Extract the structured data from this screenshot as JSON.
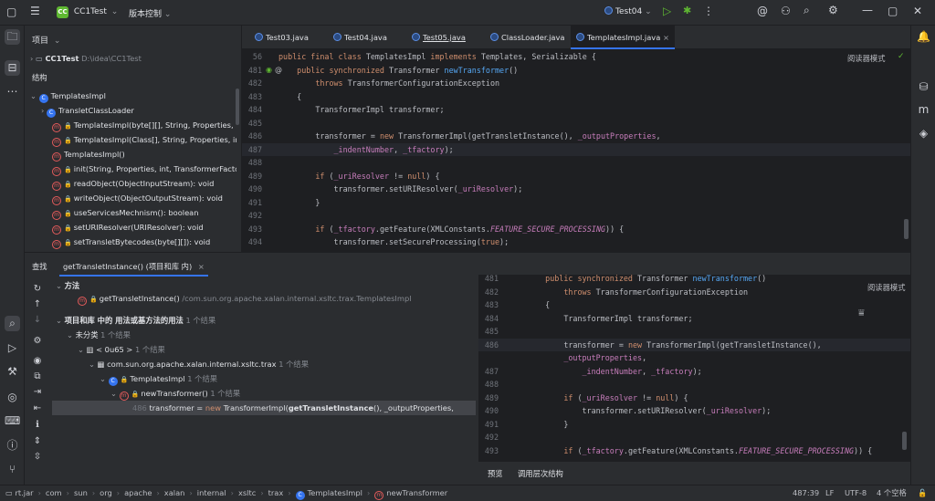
{
  "titlebar": {
    "project_badge": "CC",
    "project_name": "CC1Test",
    "project_caret": "⌄",
    "vcs_label": "版本控制",
    "vcs_caret": "⌄",
    "run_config": "Test04",
    "run_caret": "⌄"
  },
  "project_panel": {
    "title": "项目",
    "title_caret": "⌄",
    "root_name": "CC1Test",
    "root_path": "D:\\idea\\CC1Test",
    "structure_title": "结构",
    "items": [
      "TemplatesImpl",
      "TransletClassLoader",
      "TemplatesImpl(byte[][], String, Properties, int, Tr",
      "TemplatesImpl(Class[], String, Properties, int, Tra",
      "TemplatesImpl()",
      "init(String, Properties, int, TransformerFactoryIm",
      "readObject(ObjectInputStream): void",
      "writeObject(ObjectOutputStream): void",
      "useServicesMechnism(): boolean",
      "setURIResolver(URIResolver): void",
      "setTransletBytecodes(byte[][]): void"
    ]
  },
  "tabs": [
    "Test03.java",
    "Test04.java",
    "Test05.java",
    "ClassLoader.java",
    "TemplatesImpl.java"
  ],
  "reader_mode": "阅读器模式",
  "editor": {
    "lines": [
      {
        "n": "56",
        "segs": [
          [
            "kw",
            "public final class "
          ],
          [
            "cls",
            "TemplatesImpl "
          ],
          [
            "kw",
            "implements "
          ],
          [
            "cls",
            "Templates, Serializable {"
          ]
        ]
      },
      {
        "n": "481",
        "segs": [
          [
            "kw",
            "    public synchronized "
          ],
          [
            "cls",
            "Transformer "
          ],
          [
            "fn",
            "newTransformer"
          ],
          [
            "cls",
            "()"
          ]
        ]
      },
      {
        "n": "482",
        "segs": [
          [
            "kw",
            "        throws "
          ],
          [
            "cls",
            "TransformerConfigurationException"
          ]
        ]
      },
      {
        "n": "483",
        "segs": [
          [
            "cls",
            "    {"
          ]
        ]
      },
      {
        "n": "484",
        "segs": [
          [
            "cls",
            "        TransformerImpl transformer;"
          ]
        ]
      },
      {
        "n": "485",
        "segs": [
          [
            "cls",
            ""
          ]
        ]
      },
      {
        "n": "486",
        "segs": [
          [
            "cls",
            "        transformer = "
          ],
          [
            "kw",
            "new "
          ],
          [
            "cls",
            "TransformerImpl(getTransletInstance(), "
          ],
          [
            "fld",
            "_outputProperties"
          ],
          [
            "cls",
            ","
          ]
        ]
      },
      {
        "n": "487",
        "segs": [
          [
            "cls",
            "            "
          ],
          [
            "fld",
            "_indentNumber"
          ],
          [
            "cls",
            ", "
          ],
          [
            "fld",
            "_tfactory"
          ],
          [
            "cls",
            ");"
          ]
        ]
      },
      {
        "n": "488",
        "segs": [
          [
            "cls",
            ""
          ]
        ]
      },
      {
        "n": "489",
        "segs": [
          [
            "kw",
            "        if "
          ],
          [
            "cls",
            "("
          ],
          [
            "fld",
            "_uriResolver "
          ],
          [
            "cls",
            "!= "
          ],
          [
            "kw",
            "null"
          ],
          [
            "cls",
            ") {"
          ]
        ]
      },
      {
        "n": "490",
        "segs": [
          [
            "cls",
            "            transformer.setURIResolver("
          ],
          [
            "fld",
            "_uriResolver"
          ],
          [
            "cls",
            ");"
          ]
        ]
      },
      {
        "n": "491",
        "segs": [
          [
            "cls",
            "        }"
          ]
        ]
      },
      {
        "n": "492",
        "segs": [
          [
            "cls",
            ""
          ]
        ]
      },
      {
        "n": "493",
        "segs": [
          [
            "kw",
            "        if "
          ],
          [
            "cls",
            "("
          ],
          [
            "fld",
            "_tfactory"
          ],
          [
            "cls",
            ".getFeature(XMLConstants."
          ],
          [
            "fld-it",
            "FEATURE_SECURE_PROCESSING"
          ],
          [
            "cls",
            ")) {"
          ]
        ]
      },
      {
        "n": "494",
        "segs": [
          [
            "cls",
            "            transformer.setSecureProcessing("
          ],
          [
            "kw",
            "true"
          ],
          [
            "cls",
            ");"
          ]
        ]
      }
    ]
  },
  "find_panel": {
    "tab_find": "查找",
    "tab_query": "getTransletInstance() (项目和库 内)",
    "close": "×",
    "rows": [
      {
        "text": "方法",
        "cnt": ""
      },
      {
        "text": "getTransletInstance()",
        "cnt": "/com.sun.org.apache.xalan.internal.xsltc.trax.TemplatesImpl"
      },
      {
        "text": "项目和库 中的 用法或基方法的用法",
        "cnt": "1 个结果"
      },
      {
        "text": "未分类",
        "cnt": "1 个结果"
      },
      {
        "text": "< 0u65 >",
        "cnt": "1 个结果"
      },
      {
        "text": "com.sun.org.apache.xalan.internal.xsltc.trax",
        "cnt": "1 个结果"
      },
      {
        "text": "TemplatesImpl",
        "cnt": "1 个结果"
      },
      {
        "text": "newTransformer()",
        "cnt": "1 个结果"
      },
      {
        "text": "486",
        "code_pre": " transformer = ",
        "code_new": "new ",
        "code_mid": "TransformerImpl(",
        "code_bold": "getTransletInstance",
        "code_post": "(), _outputProperties,"
      }
    ],
    "preview_reader": "阅读器模式",
    "preview_lines": [
      {
        "n": "481",
        "segs": [
          [
            "kw",
            "    public synchronized "
          ],
          [
            "cls",
            "Transformer "
          ],
          [
            "fn",
            "newTransformer"
          ],
          [
            "cls",
            "()"
          ]
        ]
      },
      {
        "n": "482",
        "segs": [
          [
            "kw",
            "        throws "
          ],
          [
            "cls",
            "TransformerConfigurationException"
          ]
        ]
      },
      {
        "n": "483",
        "segs": [
          [
            "cls",
            "    {"
          ]
        ]
      },
      {
        "n": "484",
        "segs": [
          [
            "cls",
            "        TransformerImpl transformer;"
          ]
        ]
      },
      {
        "n": "485",
        "segs": [
          [
            "cls",
            ""
          ]
        ]
      },
      {
        "n": "486",
        "segs": [
          [
            "cls",
            "        transformer = "
          ],
          [
            "kw",
            "new "
          ],
          [
            "cls",
            "TransformerImpl(getTransletInstance(), "
          ]
        ]
      },
      {
        "n": "",
        "segs": [
          [
            "cls",
            "        "
          ],
          [
            "fld",
            "_outputProperties"
          ],
          [
            "cls",
            ","
          ]
        ]
      },
      {
        "n": "487",
        "segs": [
          [
            "cls",
            "            "
          ],
          [
            "fld",
            "_indentNumber"
          ],
          [
            "cls",
            ", "
          ],
          [
            "fld",
            "_tfactory"
          ],
          [
            "cls",
            ");"
          ]
        ]
      },
      {
        "n": "488",
        "segs": [
          [
            "cls",
            ""
          ]
        ]
      },
      {
        "n": "489",
        "segs": [
          [
            "kw",
            "        if "
          ],
          [
            "cls",
            "("
          ],
          [
            "fld",
            "_uriResolver "
          ],
          [
            "cls",
            "!= "
          ],
          [
            "kw",
            "null"
          ],
          [
            "cls",
            ") {"
          ]
        ]
      },
      {
        "n": "490",
        "segs": [
          [
            "cls",
            "            transformer.setURIResolver("
          ],
          [
            "fld",
            "_uriResolver"
          ],
          [
            "cls",
            ");"
          ]
        ]
      },
      {
        "n": "491",
        "segs": [
          [
            "cls",
            "        }"
          ]
        ]
      },
      {
        "n": "492",
        "segs": [
          [
            "cls",
            ""
          ]
        ]
      },
      {
        "n": "493",
        "segs": [
          [
            "kw",
            "        if "
          ],
          [
            "cls",
            "("
          ],
          [
            "fld",
            "_tfactory"
          ],
          [
            "cls",
            ".getFeature(XMLConstants."
          ],
          [
            "fld-it",
            "FEATURE_SECURE_PROCESSING"
          ],
          [
            "cls",
            ")) {"
          ]
        ]
      }
    ],
    "bottom_tabs": [
      "预览",
      "调用层次结构"
    ]
  },
  "statusbar": {
    "crumbs": [
      "rt.jar",
      "com",
      "sun",
      "org",
      "apache",
      "xalan",
      "internal",
      "xsltc",
      "trax",
      "TemplatesImpl",
      "newTransformer"
    ],
    "position": "487:39",
    "line_sep": "LF",
    "encoding": "UTF-8",
    "indent": "4 个空格"
  },
  "colors": {
    "accent": "#3574f0",
    "keyword": "#cf8e6d",
    "method": "#56a8f5",
    "field": "#c77dbb",
    "bg": "#1e1f22",
    "panel": "#2b2d30"
  }
}
